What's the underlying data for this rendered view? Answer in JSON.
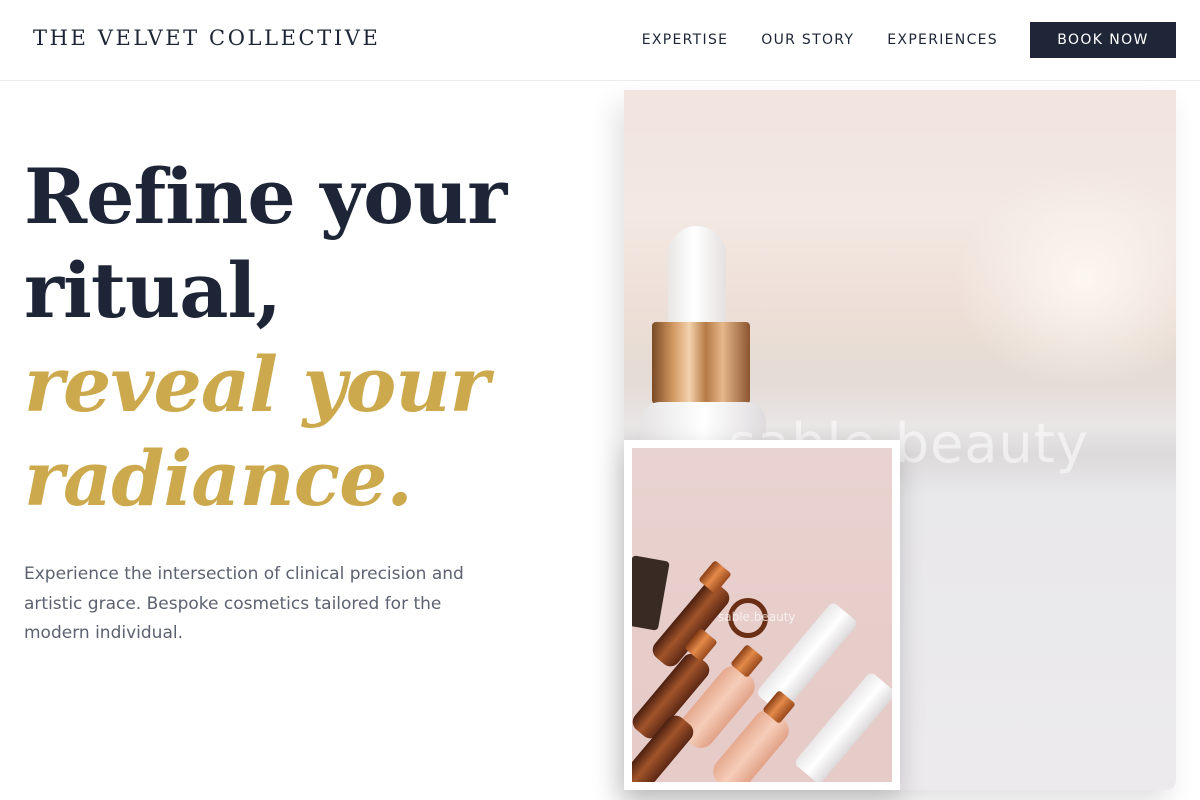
{
  "header": {
    "brand": "THE VELVET COLLECTIVE",
    "nav": [
      {
        "label": "EXPERTISE"
      },
      {
        "label": "OUR STORY"
      },
      {
        "label": "EXPERIENCES"
      }
    ],
    "cta_label": "BOOK NOW"
  },
  "hero": {
    "headline_line1": "Refine your",
    "headline_line2": "ritual,",
    "headline_accent_line1": "reveal your",
    "headline_accent_line2": "radiance.",
    "intro": "Experience the intersection of clinical precision and artistic grace. Bespoke cosmetics tailored for the modern individual.",
    "main_image_watermark": "sable.beauty",
    "product_image_watermark": "sable.beauty"
  },
  "colors": {
    "navy": "#1e2638",
    "gold_accent": "#cda94d",
    "body_text": "#5c6270"
  }
}
